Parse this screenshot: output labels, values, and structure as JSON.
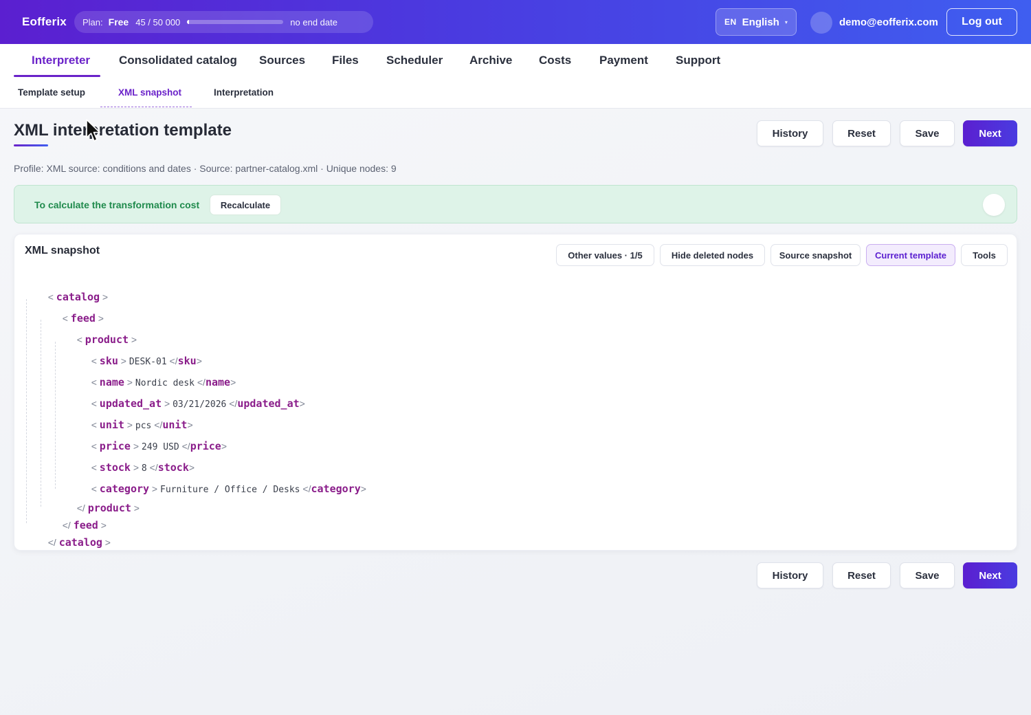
{
  "app": {
    "name": "Eofferix"
  },
  "plan": {
    "label": "Plan:",
    "tier": "Free",
    "usage": "45 / 50 000",
    "usage_fraction": 0.0009,
    "end": "no end date"
  },
  "language": {
    "code": "EN",
    "name": "English",
    "caret": "▾"
  },
  "user": {
    "email": "demo@eofferix.com",
    "logout_label": "Log out"
  },
  "nav": {
    "tabs": [
      {
        "label": "Interpreter",
        "active": true
      },
      {
        "label": "Consolidated catalog"
      },
      {
        "label": "Sources"
      },
      {
        "label": "Files"
      },
      {
        "label": "Scheduler"
      },
      {
        "label": "Archive"
      },
      {
        "label": "Costs"
      },
      {
        "label": "Payment"
      },
      {
        "label": "Support"
      }
    ],
    "subtabs": [
      {
        "label": "Template setup"
      },
      {
        "label": "XML snapshot",
        "active": true
      },
      {
        "label": "Interpretation"
      }
    ]
  },
  "page": {
    "title": "XML interpretation template",
    "meta": "Profile: XML source: conditions and dates · Source: partner-catalog.xml · Unique nodes: 9"
  },
  "actions": {
    "history": "History",
    "reset": "Reset",
    "save": "Save",
    "next": "Next"
  },
  "banner": {
    "text": "To calculate the transformation cost",
    "button": "Recalculate"
  },
  "snapshot": {
    "title": "XML snapshot",
    "tools": [
      {
        "label": "Other values · 1/5"
      },
      {
        "label": "Hide deleted nodes"
      },
      {
        "label": "Source snapshot"
      },
      {
        "label": "Current template",
        "active": true
      },
      {
        "label": "Tools"
      }
    ],
    "tree": {
      "root": "catalog",
      "feed": "feed",
      "product": "product",
      "fields": [
        {
          "tag": "sku",
          "value": "DESK-01"
        },
        {
          "tag": "name",
          "value": "Nordic desk"
        },
        {
          "tag": "updated_at",
          "value": "03/21/2026"
        },
        {
          "tag": "unit",
          "value": "pcs"
        },
        {
          "tag": "price",
          "value": "249 USD"
        },
        {
          "tag": "stock",
          "value": "8"
        },
        {
          "tag": "category",
          "value": "Furniture / Office / Desks"
        }
      ]
    }
  },
  "colors": {
    "brand_start": "#5b1fd0",
    "brand_end": "#3f5ef0",
    "accent": "#6a22c9",
    "tag": "#8a1d8a",
    "success_text": "#1f8a4c",
    "success_bg": "#def3e8"
  },
  "icons": {
    "cursor": "mouse-pointer-icon",
    "caret": "chevron-down-icon"
  }
}
